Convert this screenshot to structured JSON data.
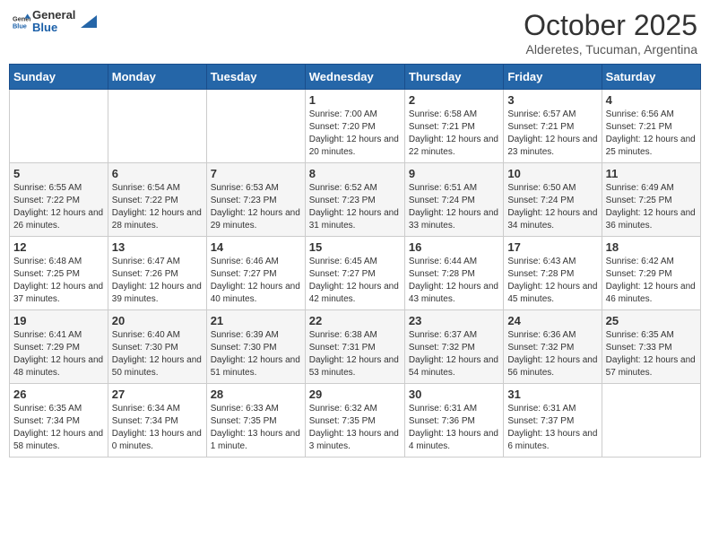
{
  "header": {
    "logo_general": "General",
    "logo_blue": "Blue",
    "month": "October 2025",
    "location": "Alderetes, Tucuman, Argentina"
  },
  "days_of_week": [
    "Sunday",
    "Monday",
    "Tuesday",
    "Wednesday",
    "Thursday",
    "Friday",
    "Saturday"
  ],
  "weeks": [
    [
      {
        "day": "",
        "sunrise": "",
        "sunset": "",
        "daylight": ""
      },
      {
        "day": "",
        "sunrise": "",
        "sunset": "",
        "daylight": ""
      },
      {
        "day": "",
        "sunrise": "",
        "sunset": "",
        "daylight": ""
      },
      {
        "day": "1",
        "sunrise": "Sunrise: 7:00 AM",
        "sunset": "Sunset: 7:20 PM",
        "daylight": "Daylight: 12 hours and 20 minutes."
      },
      {
        "day": "2",
        "sunrise": "Sunrise: 6:58 AM",
        "sunset": "Sunset: 7:21 PM",
        "daylight": "Daylight: 12 hours and 22 minutes."
      },
      {
        "day": "3",
        "sunrise": "Sunrise: 6:57 AM",
        "sunset": "Sunset: 7:21 PM",
        "daylight": "Daylight: 12 hours and 23 minutes."
      },
      {
        "day": "4",
        "sunrise": "Sunrise: 6:56 AM",
        "sunset": "Sunset: 7:21 PM",
        "daylight": "Daylight: 12 hours and 25 minutes."
      }
    ],
    [
      {
        "day": "5",
        "sunrise": "Sunrise: 6:55 AM",
        "sunset": "Sunset: 7:22 PM",
        "daylight": "Daylight: 12 hours and 26 minutes."
      },
      {
        "day": "6",
        "sunrise": "Sunrise: 6:54 AM",
        "sunset": "Sunset: 7:22 PM",
        "daylight": "Daylight: 12 hours and 28 minutes."
      },
      {
        "day": "7",
        "sunrise": "Sunrise: 6:53 AM",
        "sunset": "Sunset: 7:23 PM",
        "daylight": "Daylight: 12 hours and 29 minutes."
      },
      {
        "day": "8",
        "sunrise": "Sunrise: 6:52 AM",
        "sunset": "Sunset: 7:23 PM",
        "daylight": "Daylight: 12 hours and 31 minutes."
      },
      {
        "day": "9",
        "sunrise": "Sunrise: 6:51 AM",
        "sunset": "Sunset: 7:24 PM",
        "daylight": "Daylight: 12 hours and 33 minutes."
      },
      {
        "day": "10",
        "sunrise": "Sunrise: 6:50 AM",
        "sunset": "Sunset: 7:24 PM",
        "daylight": "Daylight: 12 hours and 34 minutes."
      },
      {
        "day": "11",
        "sunrise": "Sunrise: 6:49 AM",
        "sunset": "Sunset: 7:25 PM",
        "daylight": "Daylight: 12 hours and 36 minutes."
      }
    ],
    [
      {
        "day": "12",
        "sunrise": "Sunrise: 6:48 AM",
        "sunset": "Sunset: 7:25 PM",
        "daylight": "Daylight: 12 hours and 37 minutes."
      },
      {
        "day": "13",
        "sunrise": "Sunrise: 6:47 AM",
        "sunset": "Sunset: 7:26 PM",
        "daylight": "Daylight: 12 hours and 39 minutes."
      },
      {
        "day": "14",
        "sunrise": "Sunrise: 6:46 AM",
        "sunset": "Sunset: 7:27 PM",
        "daylight": "Daylight: 12 hours and 40 minutes."
      },
      {
        "day": "15",
        "sunrise": "Sunrise: 6:45 AM",
        "sunset": "Sunset: 7:27 PM",
        "daylight": "Daylight: 12 hours and 42 minutes."
      },
      {
        "day": "16",
        "sunrise": "Sunrise: 6:44 AM",
        "sunset": "Sunset: 7:28 PM",
        "daylight": "Daylight: 12 hours and 43 minutes."
      },
      {
        "day": "17",
        "sunrise": "Sunrise: 6:43 AM",
        "sunset": "Sunset: 7:28 PM",
        "daylight": "Daylight: 12 hours and 45 minutes."
      },
      {
        "day": "18",
        "sunrise": "Sunrise: 6:42 AM",
        "sunset": "Sunset: 7:29 PM",
        "daylight": "Daylight: 12 hours and 46 minutes."
      }
    ],
    [
      {
        "day": "19",
        "sunrise": "Sunrise: 6:41 AM",
        "sunset": "Sunset: 7:29 PM",
        "daylight": "Daylight: 12 hours and 48 minutes."
      },
      {
        "day": "20",
        "sunrise": "Sunrise: 6:40 AM",
        "sunset": "Sunset: 7:30 PM",
        "daylight": "Daylight: 12 hours and 50 minutes."
      },
      {
        "day": "21",
        "sunrise": "Sunrise: 6:39 AM",
        "sunset": "Sunset: 7:30 PM",
        "daylight": "Daylight: 12 hours and 51 minutes."
      },
      {
        "day": "22",
        "sunrise": "Sunrise: 6:38 AM",
        "sunset": "Sunset: 7:31 PM",
        "daylight": "Daylight: 12 hours and 53 minutes."
      },
      {
        "day": "23",
        "sunrise": "Sunrise: 6:37 AM",
        "sunset": "Sunset: 7:32 PM",
        "daylight": "Daylight: 12 hours and 54 minutes."
      },
      {
        "day": "24",
        "sunrise": "Sunrise: 6:36 AM",
        "sunset": "Sunset: 7:32 PM",
        "daylight": "Daylight: 12 hours and 56 minutes."
      },
      {
        "day": "25",
        "sunrise": "Sunrise: 6:35 AM",
        "sunset": "Sunset: 7:33 PM",
        "daylight": "Daylight: 12 hours and 57 minutes."
      }
    ],
    [
      {
        "day": "26",
        "sunrise": "Sunrise: 6:35 AM",
        "sunset": "Sunset: 7:34 PM",
        "daylight": "Daylight: 12 hours and 58 minutes."
      },
      {
        "day": "27",
        "sunrise": "Sunrise: 6:34 AM",
        "sunset": "Sunset: 7:34 PM",
        "daylight": "Daylight: 13 hours and 0 minutes."
      },
      {
        "day": "28",
        "sunrise": "Sunrise: 6:33 AM",
        "sunset": "Sunset: 7:35 PM",
        "daylight": "Daylight: 13 hours and 1 minute."
      },
      {
        "day": "29",
        "sunrise": "Sunrise: 6:32 AM",
        "sunset": "Sunset: 7:35 PM",
        "daylight": "Daylight: 13 hours and 3 minutes."
      },
      {
        "day": "30",
        "sunrise": "Sunrise: 6:31 AM",
        "sunset": "Sunset: 7:36 PM",
        "daylight": "Daylight: 13 hours and 4 minutes."
      },
      {
        "day": "31",
        "sunrise": "Sunrise: 6:31 AM",
        "sunset": "Sunset: 7:37 PM",
        "daylight": "Daylight: 13 hours and 6 minutes."
      },
      {
        "day": "",
        "sunrise": "",
        "sunset": "",
        "daylight": ""
      }
    ]
  ]
}
